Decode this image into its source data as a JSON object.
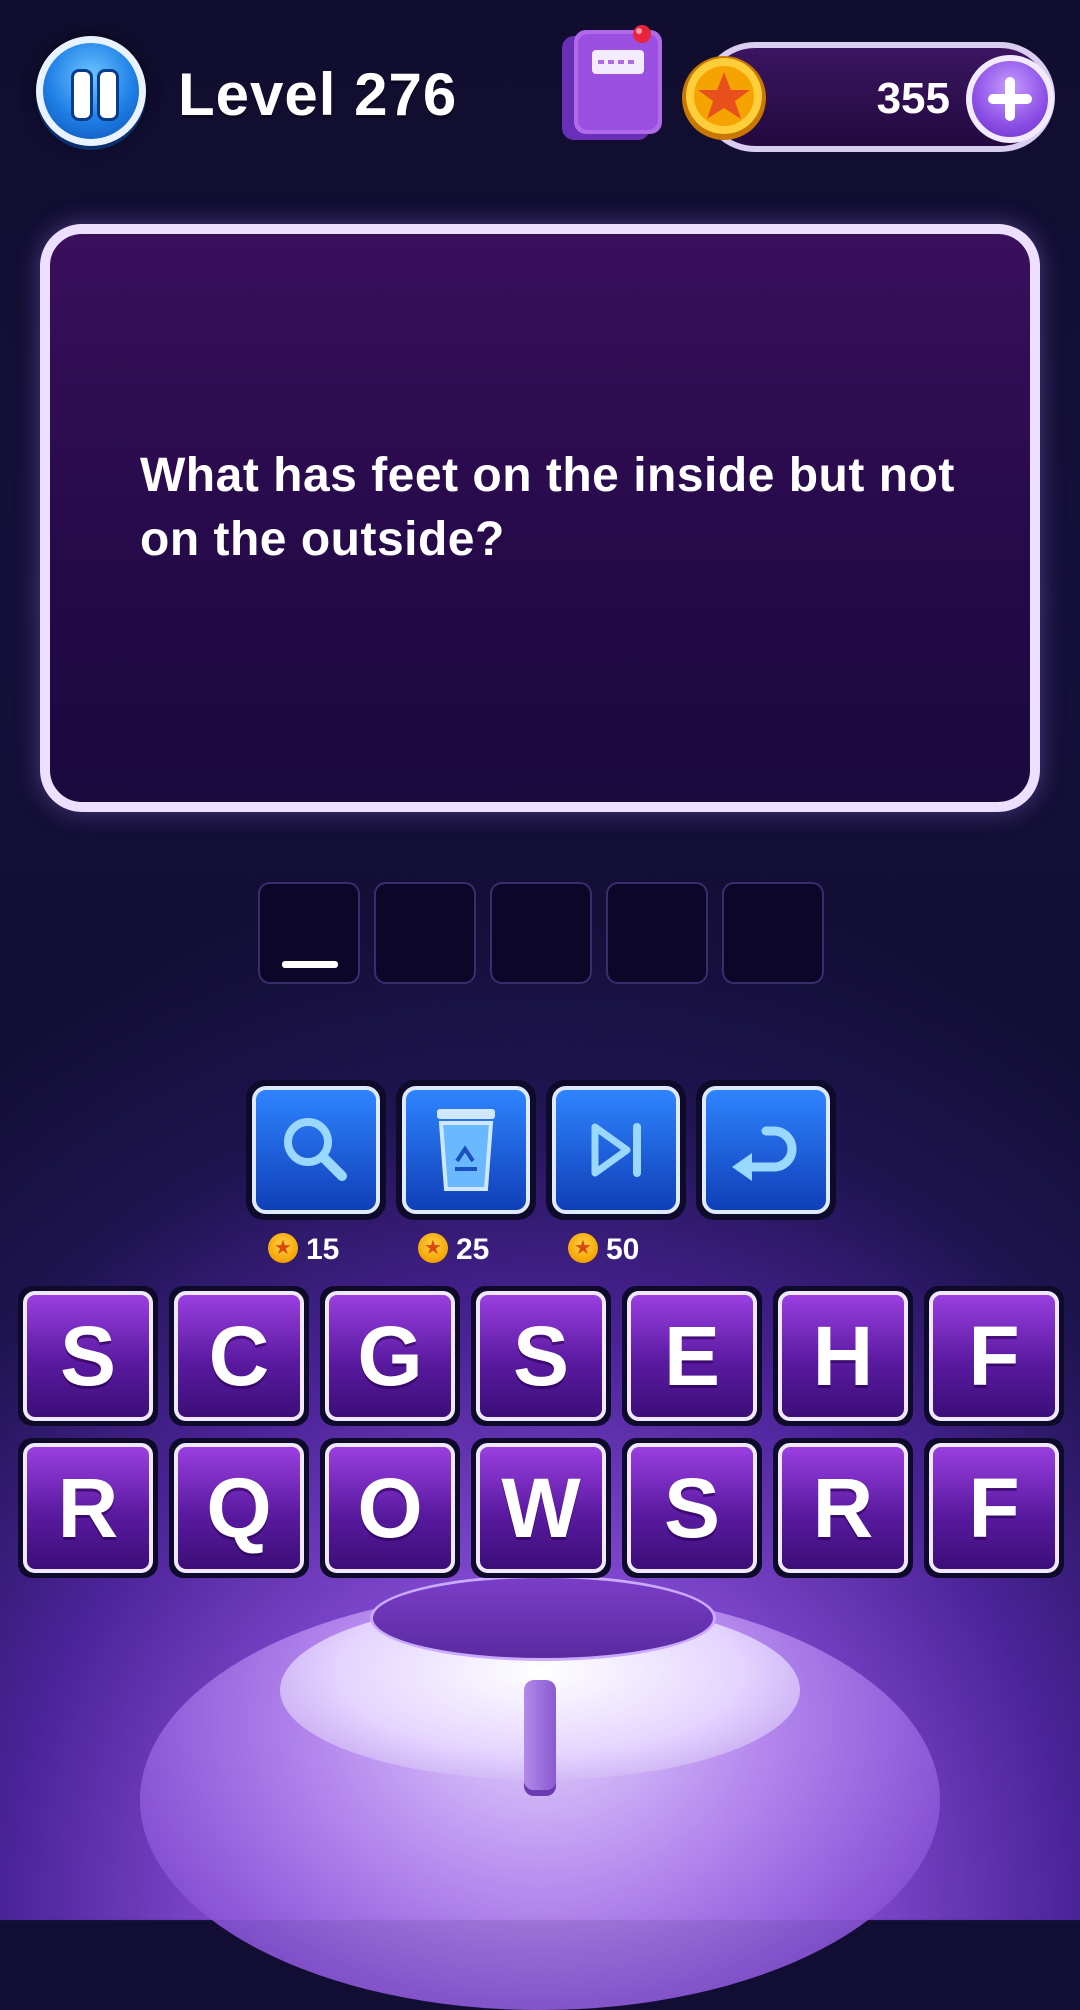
{
  "header": {
    "level_label": "Level 276",
    "coin_count": "355",
    "icons": {
      "pause": "pause-icon",
      "book": "book-icon",
      "coin": "coin-icon",
      "add": "plus-icon"
    }
  },
  "question": {
    "text": "What has feet on the inside but not on the outside?"
  },
  "answer": {
    "slot_count": 5,
    "filled": [
      "",
      "",
      "",
      "",
      ""
    ],
    "active_slot": 1
  },
  "tools": [
    {
      "name": "hint-reveal",
      "icon": "magnifier-icon",
      "cost": "15"
    },
    {
      "name": "remove-letters",
      "icon": "recycle-bin-icon",
      "cost": "25"
    },
    {
      "name": "skip-level",
      "icon": "skip-icon",
      "cost": "50"
    },
    {
      "name": "undo",
      "icon": "undo-icon",
      "cost": ""
    }
  ],
  "keyboard": {
    "row1": [
      "S",
      "C",
      "G",
      "S",
      "E",
      "H",
      "F"
    ],
    "row2": [
      "R",
      "Q",
      "O",
      "W",
      "S",
      "R",
      "F"
    ]
  },
  "colors": {
    "accent_purple": "#8c4fe6",
    "tool_blue": "#2f84ff",
    "coin_gold": "#f5a300"
  }
}
